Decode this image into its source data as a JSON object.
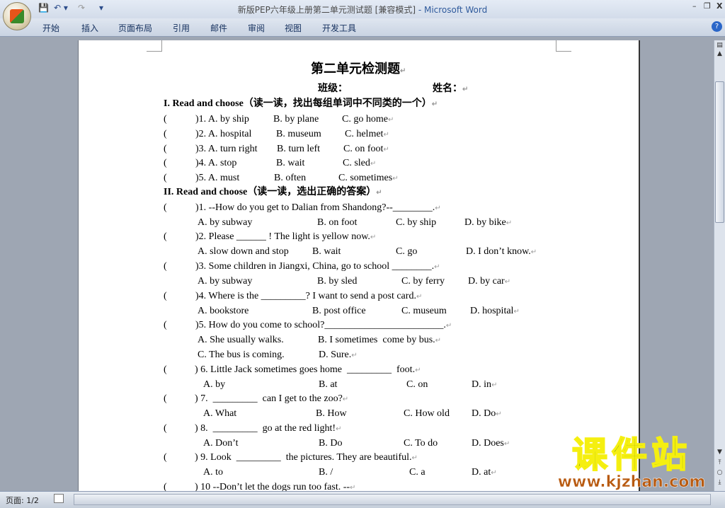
{
  "window": {
    "title": "新版PEP六年级上册第二单元测试题 [兼容模式]",
    "app": " - Microsoft Word",
    "minimize": "–",
    "restore": "❐",
    "close": "X"
  },
  "qat": {
    "save": "💾",
    "undo": "↶ ▾",
    "redo": "↷",
    "customize": "▾"
  },
  "ribbon": {
    "tabs": [
      "开始",
      "插入",
      "页面布局",
      "引用",
      "邮件",
      "审阅",
      "视图",
      "开发工具"
    ],
    "help": "?"
  },
  "doc": {
    "title": "第二单元检测题",
    "class_label": "班级：",
    "name_label": "姓名：",
    "section1": "I. Read and choose（读一读，找出每组单词中不同类的一个）",
    "s1_items": [
      {
        "num": ")1. A. by ship",
        "b": "B. by plane",
        "c": "C. go home"
      },
      {
        "num": ")2. A. hospital",
        "b": "B. museum",
        "c": "C. helmet"
      },
      {
        "num": ")3. A. turn right",
        "b": "B. turn left",
        "c": "C. on foot"
      },
      {
        "num": ")4. A. stop",
        "b": "B. wait",
        "c": "C. sled"
      },
      {
        "num": ")5. A. must",
        "b": "B. often",
        "c": "C. sometimes"
      }
    ],
    "section2": "II. Read and choose（读一读，选出正确的答案）",
    "s2_items": [
      {
        "q": ")1. --How do you get to Dalian from Shandong?--________.",
        "opts": [
          [
            "A. by subway",
            "B. on foot",
            "C. by ship",
            "D. by bike"
          ]
        ]
      },
      {
        "q": ")2. Please ______ ! The light is yellow now.",
        "opts": [
          [
            "A. slow down and stop",
            "B. wait",
            "C. go",
            "D. I don’t know."
          ]
        ]
      },
      {
        "q": ")3. Some children in Jiangxi, China, go to school ________.",
        "opts": [
          [
            "A. by subway",
            "B. by sled",
            "C. by ferry",
            "D. by car"
          ]
        ]
      },
      {
        "q": ")4. Where is the _________? I want to send a post card.",
        "opts": [
          [
            "A. bookstore",
            "B. post office",
            "C. museum",
            "D. hospital"
          ]
        ]
      },
      {
        "q": ")5. How do you come to school?________________________.",
        "opts": [
          [
            "A. She usually walks.",
            "B. I sometimes  come by bus."
          ],
          [
            "C. The bus is coming.",
            "D. Sure."
          ]
        ]
      },
      {
        "q": ") 6. Little Jack sometimes goes home  _________  foot.",
        "opts": [
          [
            "A. by",
            "B. at",
            "C. on",
            "D. in"
          ]
        ]
      },
      {
        "q": ") 7.  _________  can I get to the zoo?",
        "opts": [
          [
            "A. What",
            "B. How",
            "C. How old",
            "D. Do"
          ]
        ]
      },
      {
        "q": ") 8.  _________  go at the red light!",
        "opts": [
          [
            "A. Don’t",
            "B. Do",
            "C. To do",
            "D. Does"
          ]
        ]
      },
      {
        "q": ") 9. Look  _________  the pictures. They are beautiful.",
        "opts": [
          [
            "A. to",
            "B. /",
            "C. a",
            "D. at"
          ]
        ]
      },
      {
        "q": ") 10 --Don’t let the dogs run too fast. --",
        "opts": []
      }
    ],
    "paren": "(",
    "para_mark": "↵"
  },
  "status": {
    "page": "页面: 1/2"
  },
  "watermark": {
    "text": "课件站",
    "url": "www.kjzhan.com"
  }
}
